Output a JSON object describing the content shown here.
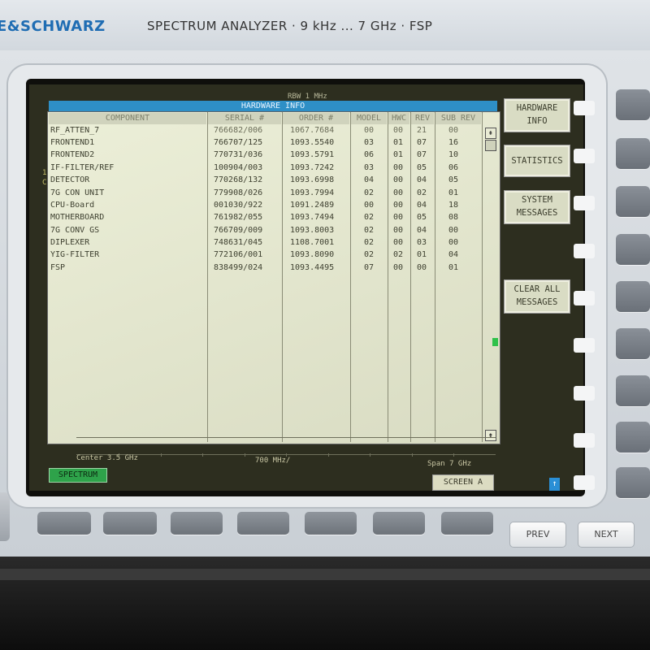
{
  "header": {
    "brand": "E&SCHWARZ",
    "model_line": "SPECTRUM ANALYZER · 9 kHz ... 7 GHz · FSP"
  },
  "display": {
    "rbw": "RBW 1 MHz",
    "title": "HARDWARE INFO",
    "columns": [
      "COMPONENT",
      "SERIAL #",
      "ORDER #",
      "MODEL",
      "HWC",
      "REV",
      "SUB REV"
    ],
    "rows": [
      [
        "RF_ATTEN_7",
        "766682/006",
        "1067.7684",
        "00",
        "00",
        "21",
        "00"
      ],
      [
        "FRONTEND1",
        "766707/125",
        "1093.5540",
        "03",
        "01",
        "07",
        "16"
      ],
      [
        "FRONTEND2",
        "770731/036",
        "1093.5791",
        "06",
        "01",
        "07",
        "10"
      ],
      [
        "IF-FILTER/REF",
        "100904/003",
        "1093.7242",
        "03",
        "00",
        "05",
        "06"
      ],
      [
        "DETECTOR",
        "770268/132",
        "1093.6998",
        "04",
        "00",
        "04",
        "05"
      ],
      [
        "7G CON UNIT",
        "779908/026",
        "1093.7994",
        "02",
        "00",
        "02",
        "01"
      ],
      [
        "CPU-Board",
        "001030/922",
        "1091.2489",
        "00",
        "00",
        "04",
        "18"
      ],
      [
        "MOTHERBOARD",
        "761982/055",
        "1093.7494",
        "02",
        "00",
        "05",
        "08"
      ],
      [
        "7G CONV GS",
        "766709/009",
        "1093.8003",
        "02",
        "00",
        "04",
        "00"
      ],
      [
        "DIPLEXER",
        "748631/045",
        "1108.7001",
        "02",
        "00",
        "03",
        "00"
      ],
      [
        "YIG-FILTER",
        "772106/001",
        "1093.8090",
        "02",
        "02",
        "01",
        "04"
      ],
      [
        "FSP",
        "838499/024",
        "1093.4495",
        "07",
        "00",
        "00",
        "01"
      ]
    ],
    "softkeys": {
      "hardware_info_1": "HARDWARE",
      "hardware_info_2": "INFO",
      "statistics": "STATISTICS",
      "system_messages_1": "SYSTEM",
      "system_messages_2": "MESSAGES",
      "clear_all_1": "CLEAR ALL",
      "clear_all_2": "MESSAGES"
    },
    "center": "Center 3.5 GHz",
    "div": "700 MHz/",
    "span": "Span 7 GHz",
    "mode": "SPECTRUM",
    "screen": "SCREEN A",
    "scroll_up_glyph": "⇞",
    "scroll_down_glyph": "⇟",
    "screen_arrow": "↑"
  },
  "keys": {
    "prev": "PREV",
    "next": "NEXT"
  },
  "colors": {
    "brand_blue": "#1f6db3",
    "title_bar": "#2e8fc6",
    "mode_green": "#2ea24a"
  }
}
